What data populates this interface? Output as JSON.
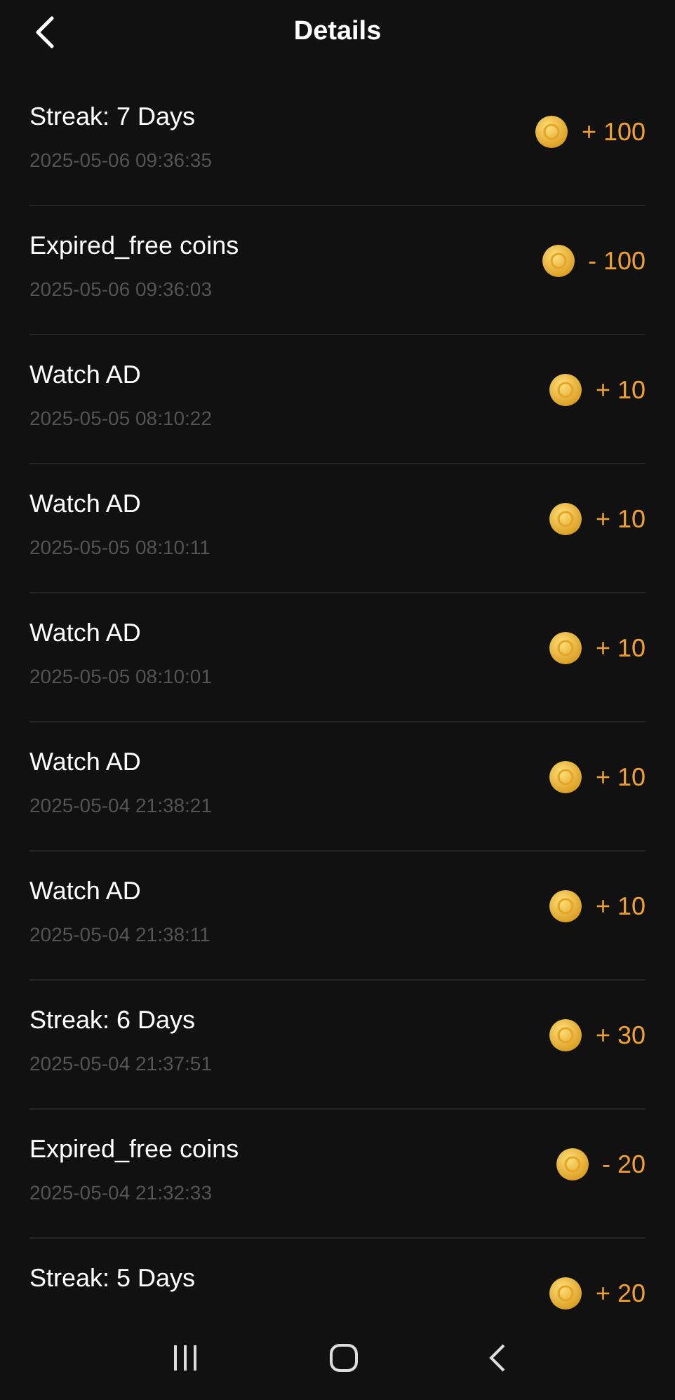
{
  "header": {
    "title": "Details"
  },
  "records": [
    {
      "title": "Streak: 7 Days",
      "time": "2025-05-06 09:36:35",
      "amount": "+ 100"
    },
    {
      "title": "Expired_free coins",
      "time": "2025-05-06 09:36:03",
      "amount": "- 100"
    },
    {
      "title": "Watch AD",
      "time": "2025-05-05 08:10:22",
      "amount": "+ 10"
    },
    {
      "title": "Watch AD",
      "time": "2025-05-05 08:10:11",
      "amount": "+ 10"
    },
    {
      "title": "Watch AD",
      "time": "2025-05-05 08:10:01",
      "amount": "+ 10"
    },
    {
      "title": "Watch AD",
      "time": "2025-05-04 21:38:21",
      "amount": "+ 10"
    },
    {
      "title": "Watch AD",
      "time": "2025-05-04 21:38:11",
      "amount": "+ 10"
    },
    {
      "title": "Streak: 6 Days",
      "time": "2025-05-04 21:37:51",
      "amount": "+ 30"
    },
    {
      "title": "Expired_free coins",
      "time": "2025-05-04 21:32:33",
      "amount": "- 20"
    },
    {
      "title": "Streak: 5 Days",
      "amount": "+ 20"
    }
  ]
}
